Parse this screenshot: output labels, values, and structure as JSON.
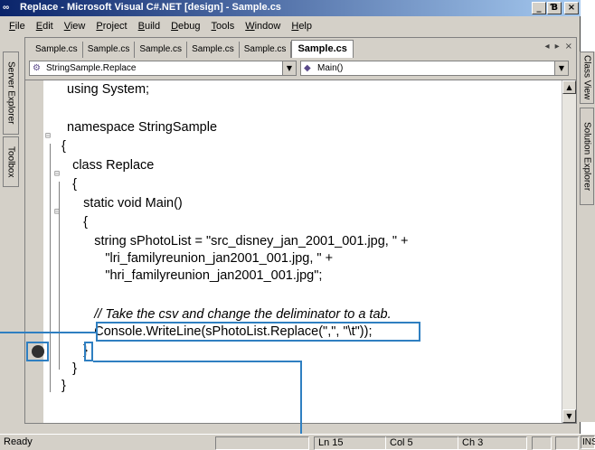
{
  "window": {
    "title": "Replace - Microsoft Visual C#.NET [design] - Sample.cs",
    "controls": [
      "_",
      "Ɓ",
      "×"
    ]
  },
  "menu": [
    {
      "label": "File",
      "ul": "F"
    },
    {
      "label": "Edit",
      "ul": "E"
    },
    {
      "label": "View",
      "ul": "V"
    },
    {
      "label": "Project",
      "ul": "P"
    },
    {
      "label": "Build",
      "ul": "B"
    },
    {
      "label": "Debug",
      "ul": "D"
    },
    {
      "label": "Tools",
      "ul": "T"
    },
    {
      "label": "Window",
      "ul": "W"
    },
    {
      "label": "Help",
      "ul": "H"
    }
  ],
  "left_panels": [
    "Server Explorer",
    "Toolbox"
  ],
  "right_panels": [
    "Class View",
    "Solution Explorer"
  ],
  "tabs": [
    "Sample.cs",
    "Sample.cs",
    "Sample.cs",
    "Sample.cs",
    "Sample.cs",
    "Sample.cs"
  ],
  "tab_nav": [
    "◂",
    "▸",
    "×"
  ],
  "navbar": {
    "type_combo": "StringSample.Replace",
    "member_combo": "Main()"
  },
  "code": [
    "using System;",
    "",
    "namespace StringSample",
    "{",
    "   class Replace",
    "   {",
    "      static void Main()",
    "      {",
    "         string sPhotoList = \"src_disney_jan_2001_001.jpg, \" +",
    "            \"lri_familyreunion_jan2001_001.jpg, \" +",
    "            \"hri_familyreunion_jan2001_001.jpg\";",
    "",
    "         // Take the csv and change the deliminator to a tab.",
    "         Console.WriteLine(sPhotoList.Replace(\",\", \"\\t\"));",
    "      }",
    "   }",
    "}"
  ],
  "status": {
    "ready": "Ready",
    "line": "Ln 15",
    "col": "Col 5",
    "ch": "Ch 3",
    "ins": "INS"
  },
  "colors": {
    "title_start": "#0a246a",
    "title_end": "#a6caf0",
    "callout": "#2f7fc1",
    "chrome": "#d4d0c8"
  }
}
